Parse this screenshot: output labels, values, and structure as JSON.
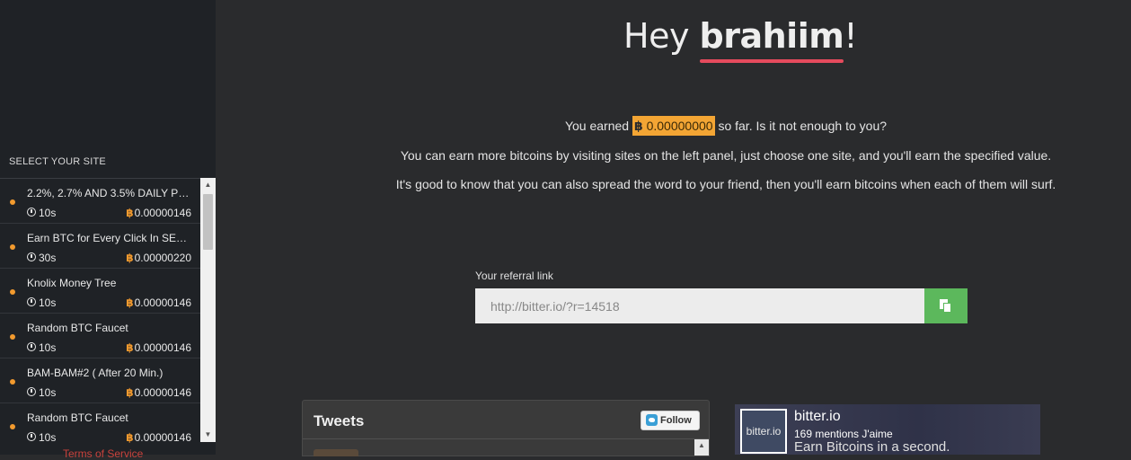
{
  "sidebar": {
    "title": "SELECT YOUR SITE",
    "items": [
      {
        "name": "2.2%, 2.7% AND 3.5% DAILY PR...",
        "time": "10s",
        "reward": "0.00000146"
      },
      {
        "name": "Earn BTC for Every Click In SECO...",
        "time": "30s",
        "reward": "0.00000220"
      },
      {
        "name": "Knolix Money Tree",
        "time": "10s",
        "reward": "0.00000146"
      },
      {
        "name": "Random BTC Faucet",
        "time": "10s",
        "reward": "0.00000146"
      },
      {
        "name": "BAM-BAM#2 ( After 20 Min.)",
        "time": "10s",
        "reward": "0.00000146"
      },
      {
        "name": "Random BTC Faucet",
        "time": "10s",
        "reward": "0.00000146"
      }
    ],
    "terms_link": "Terms of Service"
  },
  "greeting": {
    "hey": "Hey ",
    "username": "brahiim",
    "exclaim": "!"
  },
  "earned": {
    "prefix": "You earned ",
    "btc_symbol": "฿",
    "amount": " 0.00000000",
    "suffix": " so far. Is it not enough to you?"
  },
  "info": {
    "line1": "You can earn more bitcoins by visiting sites on the left panel, just choose one site, and you'll earn the specified value.",
    "line2": "It's good to know that you can also spread the word to your friend, then you'll earn bitcoins when each of them will surf."
  },
  "referral": {
    "label": "Your referral link",
    "value": "http://bitter.io/?r=14518",
    "copy_icon": "copy-icon"
  },
  "tweets": {
    "title": "Tweets",
    "follow_label": "Follow"
  },
  "facebook": {
    "logo_text": "bitter.io",
    "name": "bitter.io",
    "likes": "169 mentions J'aime",
    "tagline": "Earn Bitcoins in a second."
  },
  "colors": {
    "accent_orange": "#f3a534",
    "underline_red": "#e54b5d",
    "copy_green": "#5cb85c",
    "sidebar_bg": "#1f2226",
    "main_bg": "#2a2b2d"
  }
}
